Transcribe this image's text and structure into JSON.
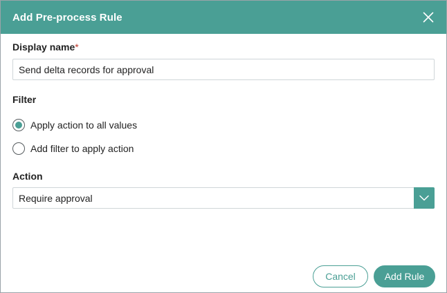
{
  "dialog": {
    "title": "Add Pre-process Rule"
  },
  "display_name": {
    "label": "Display name",
    "required_marker": "*",
    "value": "Send delta records for approval"
  },
  "filter": {
    "label": "Filter",
    "options": [
      {
        "label": "Apply action to all values",
        "selected": true
      },
      {
        "label": "Add filter to apply action",
        "selected": false
      }
    ]
  },
  "action": {
    "label": "Action",
    "selected": "Require approval"
  },
  "footer": {
    "cancel_label": "Cancel",
    "submit_label": "Add Rule"
  },
  "colors": {
    "accent": "#4a9f95",
    "required": "#c0392b"
  },
  "icons": {
    "close": "close-icon",
    "dropdown": "chevron-down-icon"
  }
}
